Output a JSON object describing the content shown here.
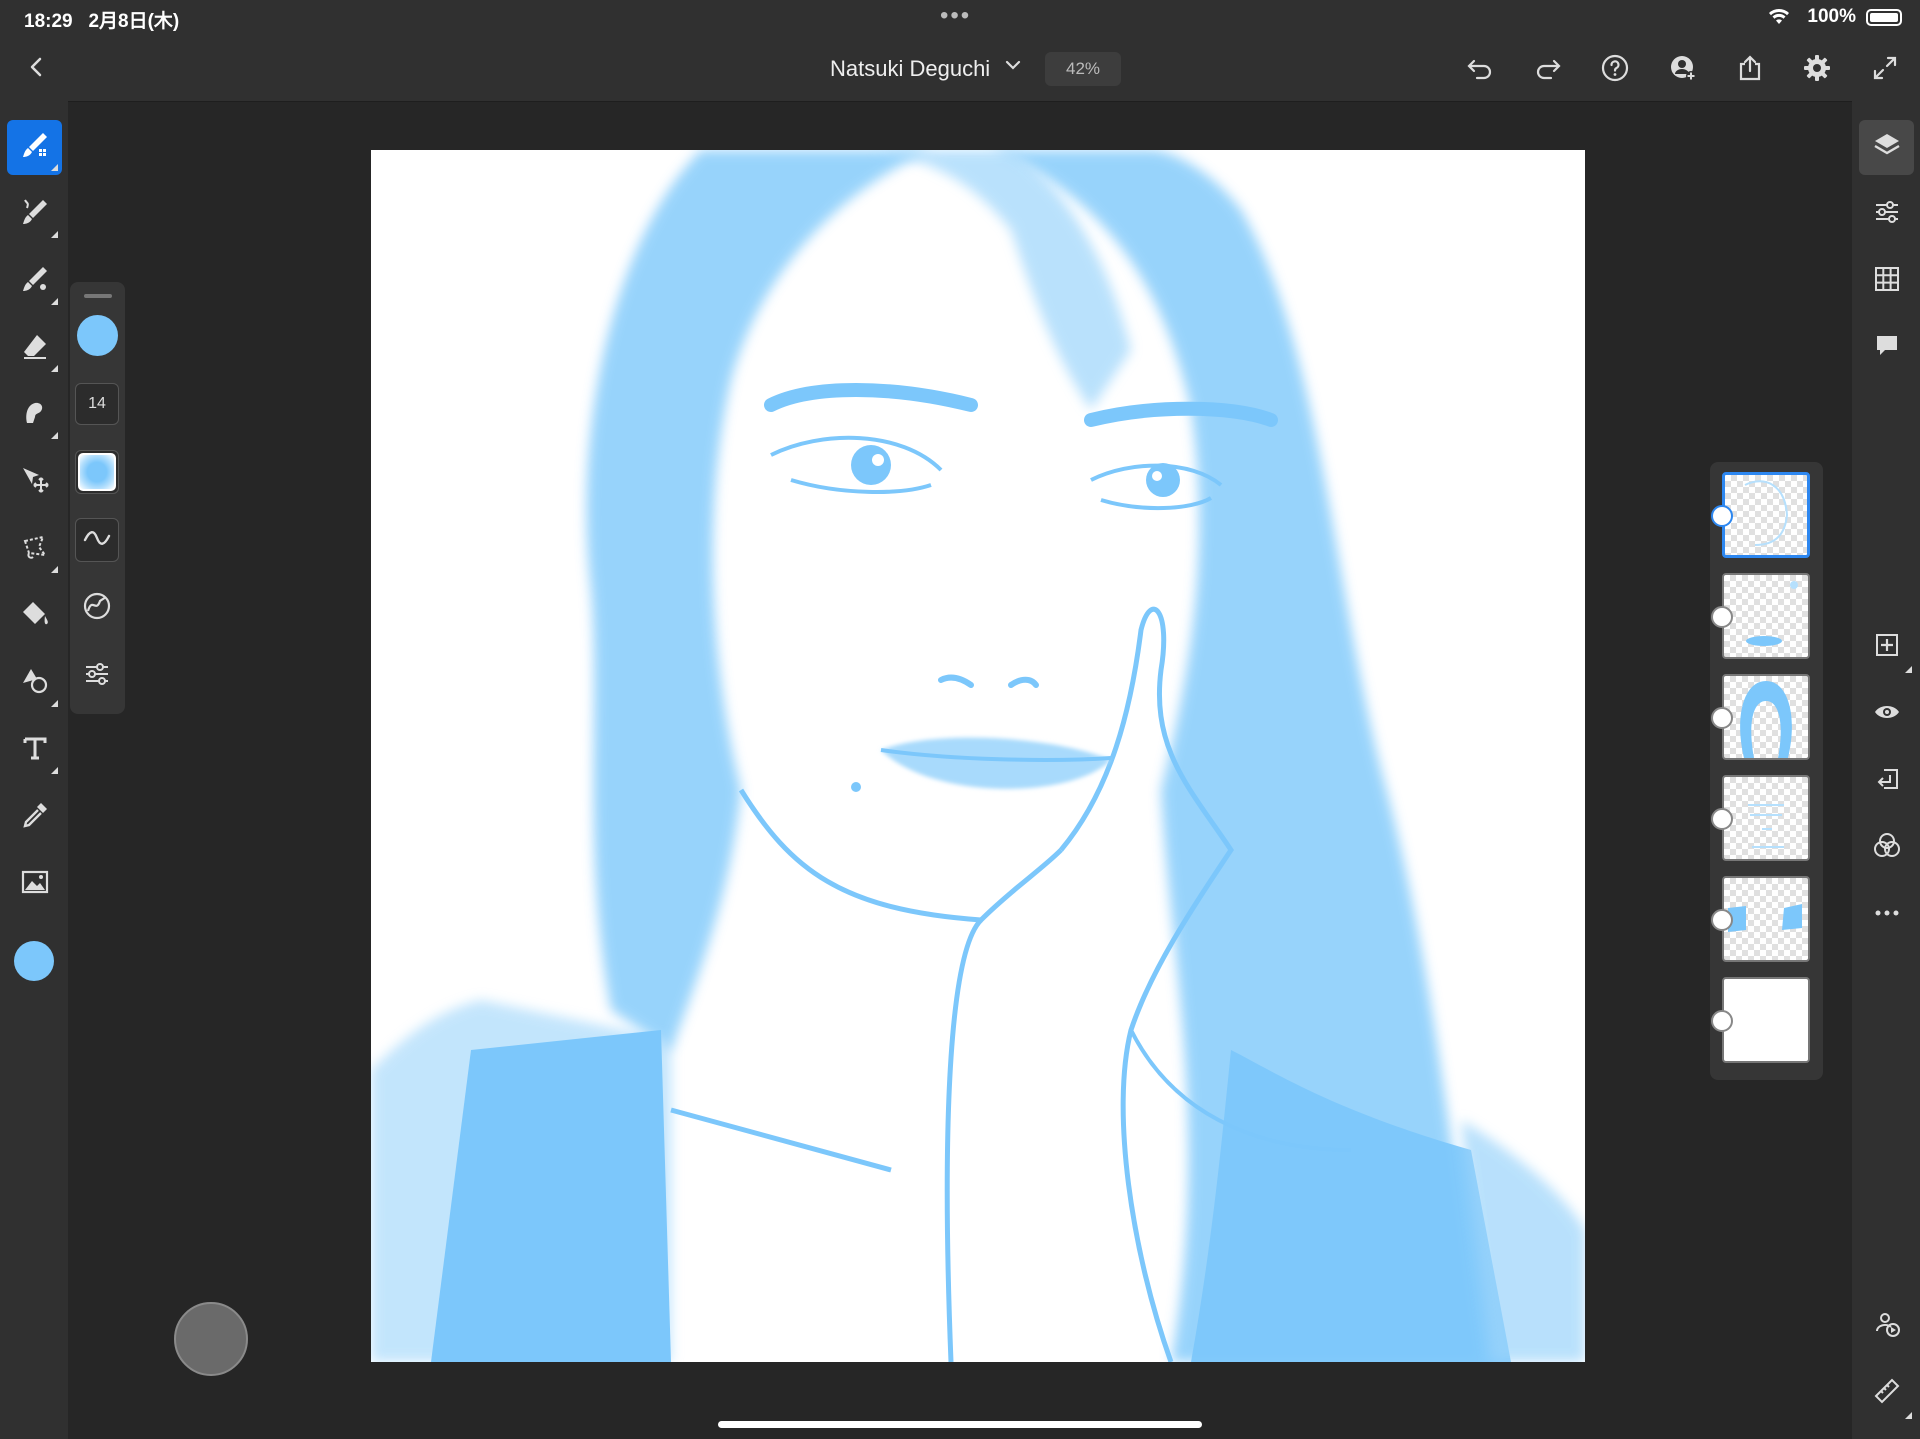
{
  "status_bar": {
    "time": "18:29",
    "date": "2月8日(木)",
    "battery": "100%"
  },
  "header": {
    "title": "Natsuki Deguchi",
    "zoom": "42%"
  },
  "brush_panel": {
    "brush_size": "14"
  },
  "colors": {
    "current_color": "#7cc7fb",
    "accent": "#1473e6"
  },
  "left_tools": [
    "brush-pixel",
    "brush-live",
    "brush-vector",
    "eraser",
    "smudge",
    "move-transform",
    "lasso-select",
    "fill",
    "shape",
    "type",
    "eyedropper",
    "image-place"
  ],
  "right_tools": [
    "layers",
    "layer-properties",
    "grid",
    "comments",
    "add-layer",
    "visibility",
    "import",
    "blend-mode",
    "more",
    "collaborate",
    "ruler"
  ],
  "layers": [
    {
      "name": "layer-1",
      "selected": true
    },
    {
      "name": "layer-2",
      "selected": false
    },
    {
      "name": "layer-3",
      "selected": false
    },
    {
      "name": "layer-4",
      "selected": false
    },
    {
      "name": "layer-5",
      "selected": false
    },
    {
      "name": "background",
      "selected": false
    }
  ]
}
